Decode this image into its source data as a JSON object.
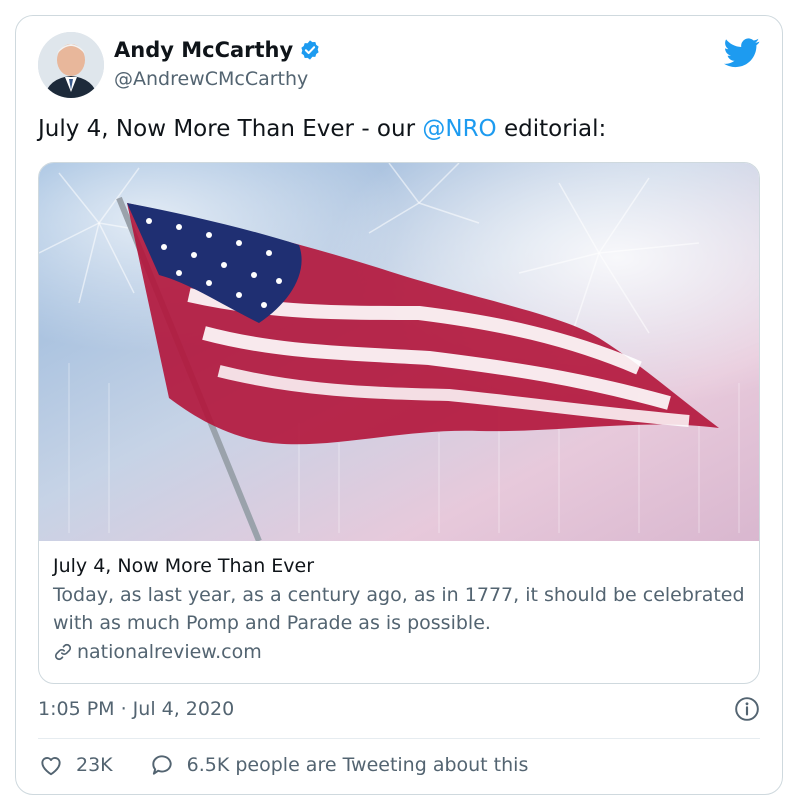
{
  "author": {
    "name": "Andy McCarthy",
    "handle": "@AndrewCMcCarthy",
    "verified": true
  },
  "tweet": {
    "text_before": "July 4, Now More Than Ever - our ",
    "mention": "@NRO",
    "text_after": " editorial:"
  },
  "link_card": {
    "title": "July 4, Now More Than Ever",
    "description": "Today, as last year, as a century ago, as in 1777, it should be celebrated with as much Pomp and Parade as is possible.",
    "domain": "nationalreview.com"
  },
  "meta": {
    "timestamp": "1:05 PM · Jul 4, 2020"
  },
  "actions": {
    "likes": "23K",
    "conversation": "6.5K people are Tweeting about this"
  },
  "colors": {
    "accent": "#1d9bf0",
    "text": "#0f1419",
    "secondary": "#536471",
    "border": "#cfd9de"
  }
}
